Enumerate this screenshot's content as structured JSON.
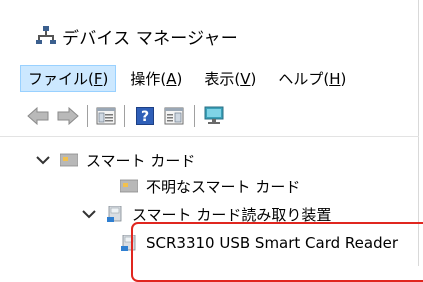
{
  "window": {
    "title": "デバイス マネージャー",
    "icon": "device-manager-icon"
  },
  "menu": [
    {
      "label": "ファイル(",
      "mnemonic": "F",
      "tail": ")"
    },
    {
      "label": "操作(",
      "mnemonic": "A",
      "tail": ")"
    },
    {
      "label": "表示(",
      "mnemonic": "V",
      "tail": ")"
    },
    {
      "label": "ヘルプ(",
      "mnemonic": "H",
      "tail": ")"
    }
  ],
  "toolbar": {
    "buttons": [
      "back-arrow-icon",
      "forward-arrow-icon",
      "properties-icon",
      "help-icon",
      "console-icon",
      "monitor-icon"
    ]
  },
  "tree": {
    "items": [
      {
        "label": "スマート カード",
        "expanded": true,
        "icon": "smart-card-category-icon"
      },
      {
        "label": "不明なスマート カード",
        "icon": "smart-card-icon"
      },
      {
        "label": "スマート カード読み取り装置",
        "expanded": true,
        "icon": "card-reader-category-icon"
      },
      {
        "label": "SCR3310 USB Smart Card Reader",
        "icon": "card-reader-icon"
      }
    ]
  },
  "colors": {
    "highlight": "#e0261f",
    "menu_active_bg": "#cce8ff",
    "icon_blue": "#2f7fd1",
    "icon_teal": "#3aa0b8"
  }
}
